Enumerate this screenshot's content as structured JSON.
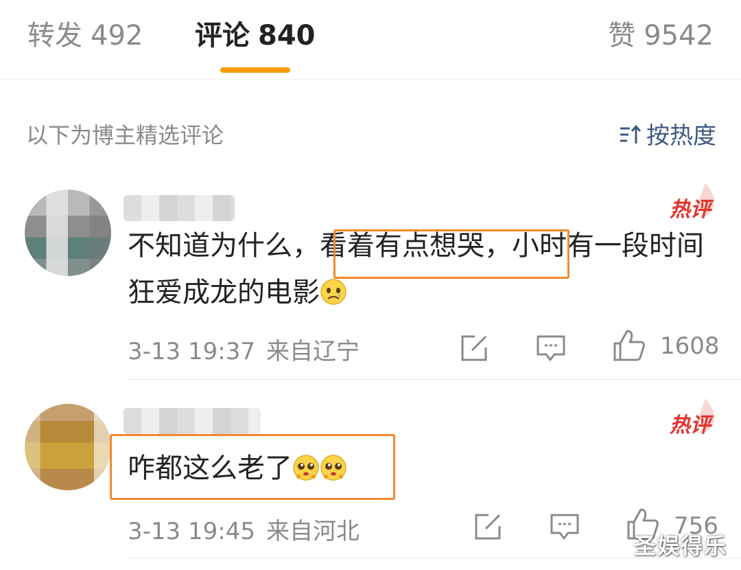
{
  "tabs": [
    {
      "label": "转发",
      "count": "492"
    },
    {
      "label": "评论",
      "count": "840"
    },
    {
      "label": "赞",
      "count": "9542"
    }
  ],
  "colors": {
    "accent": "#ff9d0a",
    "hot": "#e5322d",
    "link": "#3d5a80",
    "highlight_box": "#f08a2c"
  },
  "section": {
    "title": "以下为博主精选评论",
    "sort_label": "按热度"
  },
  "comments": [
    {
      "badge": "热评",
      "text_before": "不知道为什么，",
      "text_highlight": "看着有点想哭，",
      "text_after": "小时有一段时间狂爱成龙的电影",
      "emoji": "sad-face",
      "time": "3-13 19:37",
      "location": "来自辽宁",
      "likes": "1608"
    },
    {
      "badge": "热评",
      "text": "咋都这么老了",
      "emoji": "pleading-face",
      "time": "3-13 19:45",
      "location": "来自河北",
      "likes": "756"
    }
  ],
  "watermark": "圣娱得乐"
}
